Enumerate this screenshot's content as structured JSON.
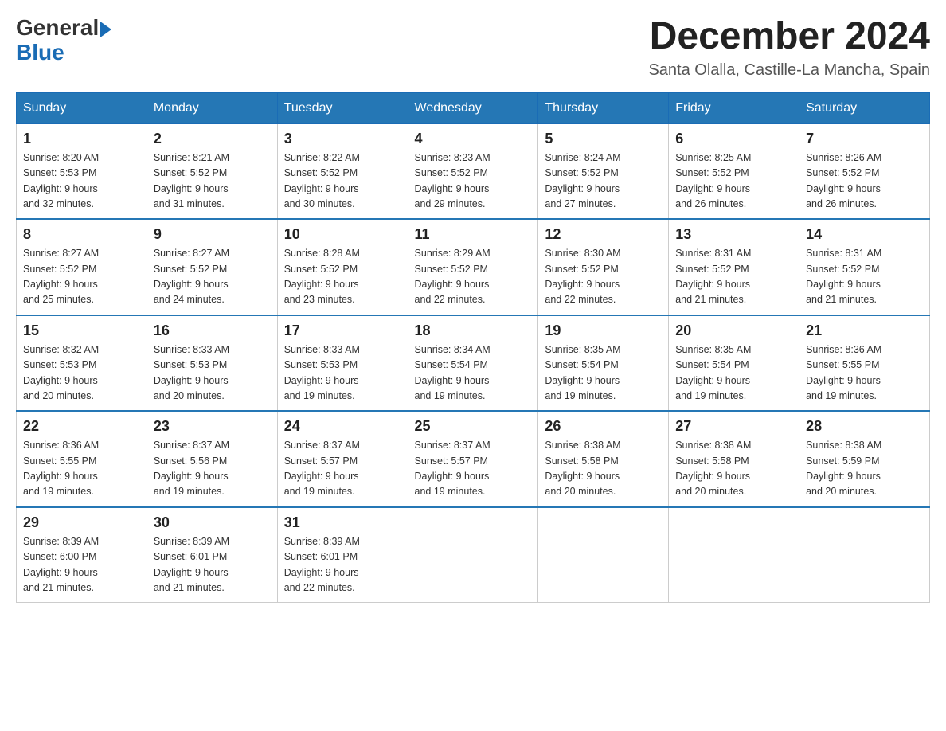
{
  "header": {
    "logo_general": "General",
    "logo_blue": "Blue",
    "month_title": "December 2024",
    "subtitle": "Santa Olalla, Castille-La Mancha, Spain"
  },
  "weekdays": [
    "Sunday",
    "Monday",
    "Tuesday",
    "Wednesday",
    "Thursday",
    "Friday",
    "Saturday"
  ],
  "weeks": [
    [
      {
        "day": "1",
        "sunrise": "8:20 AM",
        "sunset": "5:53 PM",
        "daylight": "9 hours and 32 minutes."
      },
      {
        "day": "2",
        "sunrise": "8:21 AM",
        "sunset": "5:52 PM",
        "daylight": "9 hours and 31 minutes."
      },
      {
        "day": "3",
        "sunrise": "8:22 AM",
        "sunset": "5:52 PM",
        "daylight": "9 hours and 30 minutes."
      },
      {
        "day": "4",
        "sunrise": "8:23 AM",
        "sunset": "5:52 PM",
        "daylight": "9 hours and 29 minutes."
      },
      {
        "day": "5",
        "sunrise": "8:24 AM",
        "sunset": "5:52 PM",
        "daylight": "9 hours and 27 minutes."
      },
      {
        "day": "6",
        "sunrise": "8:25 AM",
        "sunset": "5:52 PM",
        "daylight": "9 hours and 26 minutes."
      },
      {
        "day": "7",
        "sunrise": "8:26 AM",
        "sunset": "5:52 PM",
        "daylight": "9 hours and 26 minutes."
      }
    ],
    [
      {
        "day": "8",
        "sunrise": "8:27 AM",
        "sunset": "5:52 PM",
        "daylight": "9 hours and 25 minutes."
      },
      {
        "day": "9",
        "sunrise": "8:27 AM",
        "sunset": "5:52 PM",
        "daylight": "9 hours and 24 minutes."
      },
      {
        "day": "10",
        "sunrise": "8:28 AM",
        "sunset": "5:52 PM",
        "daylight": "9 hours and 23 minutes."
      },
      {
        "day": "11",
        "sunrise": "8:29 AM",
        "sunset": "5:52 PM",
        "daylight": "9 hours and 22 minutes."
      },
      {
        "day": "12",
        "sunrise": "8:30 AM",
        "sunset": "5:52 PM",
        "daylight": "9 hours and 22 minutes."
      },
      {
        "day": "13",
        "sunrise": "8:31 AM",
        "sunset": "5:52 PM",
        "daylight": "9 hours and 21 minutes."
      },
      {
        "day": "14",
        "sunrise": "8:31 AM",
        "sunset": "5:52 PM",
        "daylight": "9 hours and 21 minutes."
      }
    ],
    [
      {
        "day": "15",
        "sunrise": "8:32 AM",
        "sunset": "5:53 PM",
        "daylight": "9 hours and 20 minutes."
      },
      {
        "day": "16",
        "sunrise": "8:33 AM",
        "sunset": "5:53 PM",
        "daylight": "9 hours and 20 minutes."
      },
      {
        "day": "17",
        "sunrise": "8:33 AM",
        "sunset": "5:53 PM",
        "daylight": "9 hours and 19 minutes."
      },
      {
        "day": "18",
        "sunrise": "8:34 AM",
        "sunset": "5:54 PM",
        "daylight": "9 hours and 19 minutes."
      },
      {
        "day": "19",
        "sunrise": "8:35 AM",
        "sunset": "5:54 PM",
        "daylight": "9 hours and 19 minutes."
      },
      {
        "day": "20",
        "sunrise": "8:35 AM",
        "sunset": "5:54 PM",
        "daylight": "9 hours and 19 minutes."
      },
      {
        "day": "21",
        "sunrise": "8:36 AM",
        "sunset": "5:55 PM",
        "daylight": "9 hours and 19 minutes."
      }
    ],
    [
      {
        "day": "22",
        "sunrise": "8:36 AM",
        "sunset": "5:55 PM",
        "daylight": "9 hours and 19 minutes."
      },
      {
        "day": "23",
        "sunrise": "8:37 AM",
        "sunset": "5:56 PM",
        "daylight": "9 hours and 19 minutes."
      },
      {
        "day": "24",
        "sunrise": "8:37 AM",
        "sunset": "5:57 PM",
        "daylight": "9 hours and 19 minutes."
      },
      {
        "day": "25",
        "sunrise": "8:37 AM",
        "sunset": "5:57 PM",
        "daylight": "9 hours and 19 minutes."
      },
      {
        "day": "26",
        "sunrise": "8:38 AM",
        "sunset": "5:58 PM",
        "daylight": "9 hours and 20 minutes."
      },
      {
        "day": "27",
        "sunrise": "8:38 AM",
        "sunset": "5:58 PM",
        "daylight": "9 hours and 20 minutes."
      },
      {
        "day": "28",
        "sunrise": "8:38 AM",
        "sunset": "5:59 PM",
        "daylight": "9 hours and 20 minutes."
      }
    ],
    [
      {
        "day": "29",
        "sunrise": "8:39 AM",
        "sunset": "6:00 PM",
        "daylight": "9 hours and 21 minutes."
      },
      {
        "day": "30",
        "sunrise": "8:39 AM",
        "sunset": "6:01 PM",
        "daylight": "9 hours and 21 minutes."
      },
      {
        "day": "31",
        "sunrise": "8:39 AM",
        "sunset": "6:01 PM",
        "daylight": "9 hours and 22 minutes."
      },
      null,
      null,
      null,
      null
    ]
  ],
  "labels": {
    "sunrise": "Sunrise:",
    "sunset": "Sunset:",
    "daylight": "Daylight:"
  }
}
